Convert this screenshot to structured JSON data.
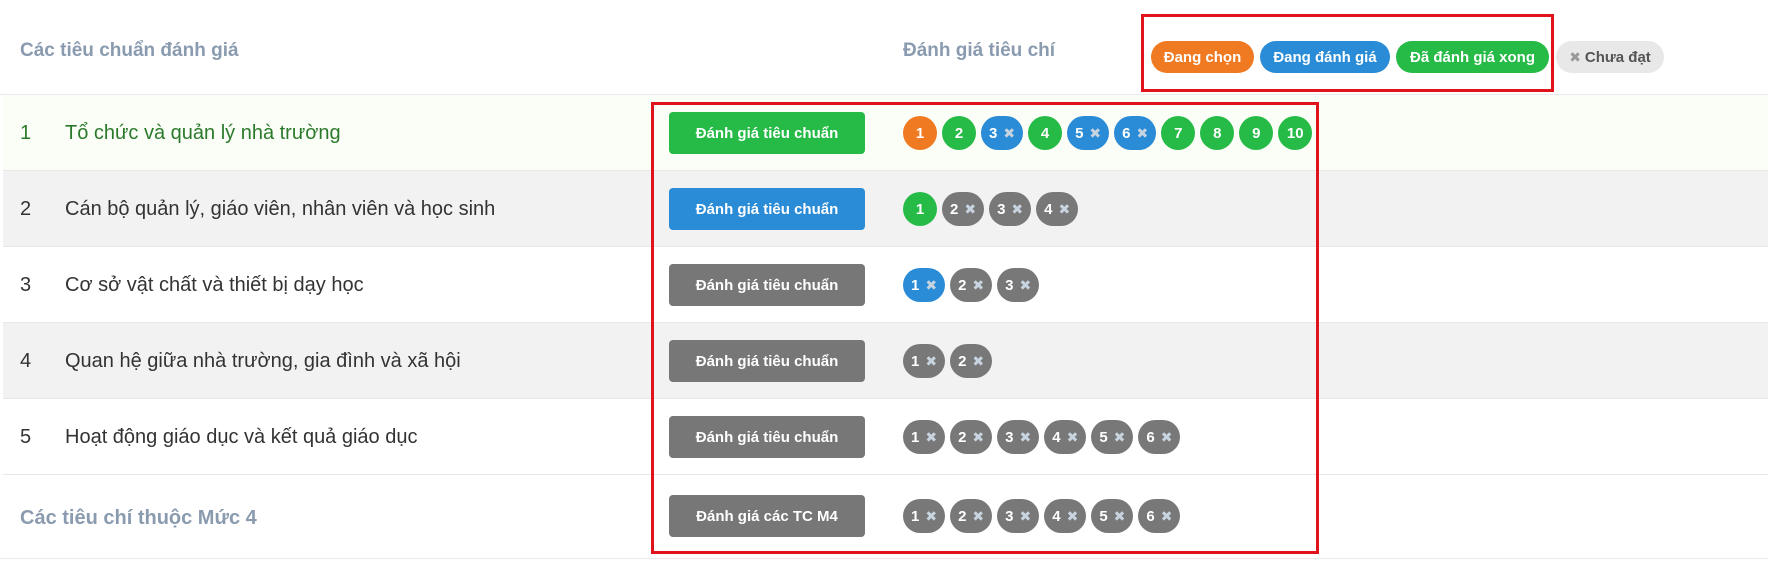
{
  "header": {
    "left_title": "Các tiêu chuẩn đánh giá",
    "mid_title": "Đánh giá tiêu chí"
  },
  "legend": [
    {
      "label": "Đang chọn",
      "color": "#f07a22"
    },
    {
      "label": "Đang đánh giá",
      "color": "#2a8bd6"
    },
    {
      "label": "Đã đánh giá xong",
      "color": "#26bb47"
    },
    {
      "label": "Chưa đạt",
      "icon": "x-icon"
    }
  ],
  "rows": [
    {
      "num": "1",
      "title": "Tổ chức và quản lý nhà trường",
      "button": "Đánh giá tiêu chuẩn",
      "button_color": "#26bb47",
      "chips": [
        {
          "label": "1",
          "state": "orange",
          "fail": false
        },
        {
          "label": "2",
          "state": "green",
          "fail": false
        },
        {
          "label": "3",
          "state": "blue",
          "fail": true
        },
        {
          "label": "4",
          "state": "green",
          "fail": false
        },
        {
          "label": "5",
          "state": "blue",
          "fail": true
        },
        {
          "label": "6",
          "state": "blue",
          "fail": true
        },
        {
          "label": "7",
          "state": "green",
          "fail": false
        },
        {
          "label": "8",
          "state": "green",
          "fail": false
        },
        {
          "label": "9",
          "state": "green",
          "fail": false
        },
        {
          "label": "10",
          "state": "green",
          "fail": false
        }
      ]
    },
    {
      "num": "2",
      "title": "Cán bộ quản lý, giáo viên, nhân viên và học sinh",
      "button": "Đánh giá tiêu chuẩn",
      "button_color": "#2a8bd6",
      "chips": [
        {
          "label": "1",
          "state": "green",
          "fail": false
        },
        {
          "label": "2",
          "state": "gray",
          "fail": true
        },
        {
          "label": "3",
          "state": "gray",
          "fail": true
        },
        {
          "label": "4",
          "state": "gray",
          "fail": true
        }
      ]
    },
    {
      "num": "3",
      "title": "Cơ sở vật chất và thiết bị dạy học",
      "button": "Đánh giá tiêu chuẩn",
      "button_color": "#777777",
      "chips": [
        {
          "label": "1",
          "state": "blue",
          "fail": true
        },
        {
          "label": "2",
          "state": "gray",
          "fail": true
        },
        {
          "label": "3",
          "state": "gray",
          "fail": true
        }
      ]
    },
    {
      "num": "4",
      "title": "Quan hệ giữa nhà trường, gia đình và xã hội",
      "button": "Đánh giá tiêu chuẩn",
      "button_color": "#777777",
      "chips": [
        {
          "label": "1",
          "state": "gray",
          "fail": true
        },
        {
          "label": "2",
          "state": "gray",
          "fail": true
        }
      ]
    },
    {
      "num": "5",
      "title": "Hoạt động giáo dục và kết quả giáo dục",
      "button": "Đánh giá tiêu chuẩn",
      "button_color": "#777777",
      "chips": [
        {
          "label": "1",
          "state": "gray",
          "fail": true
        },
        {
          "label": "2",
          "state": "gray",
          "fail": true
        },
        {
          "label": "3",
          "state": "gray",
          "fail": true
        },
        {
          "label": "4",
          "state": "gray",
          "fail": true
        },
        {
          "label": "5",
          "state": "gray",
          "fail": true
        },
        {
          "label": "6",
          "state": "gray",
          "fail": true
        }
      ]
    }
  ],
  "footer": {
    "title": "Các tiêu chí thuộc Mức 4",
    "button": "Đánh giá các TC M4",
    "chips": [
      {
        "label": "1",
        "state": "gray",
        "fail": true
      },
      {
        "label": "2",
        "state": "gray",
        "fail": true
      },
      {
        "label": "3",
        "state": "gray",
        "fail": true
      },
      {
        "label": "4",
        "state": "gray",
        "fail": true
      },
      {
        "label": "5",
        "state": "gray",
        "fail": true
      },
      {
        "label": "6",
        "state": "gray",
        "fail": true
      }
    ]
  }
}
